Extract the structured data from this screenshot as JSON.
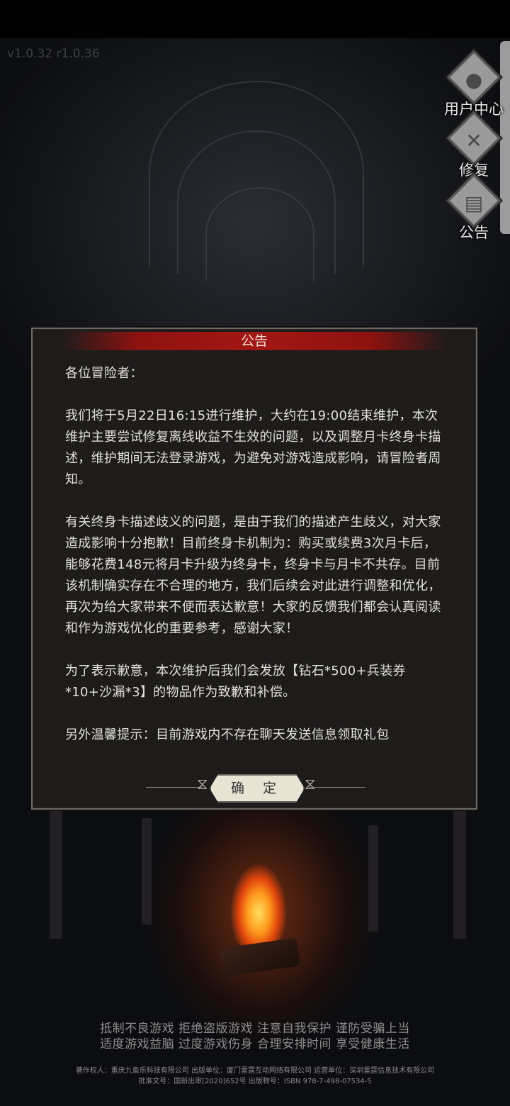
{
  "version": "v1.0.32 r1.0.36",
  "side_menu": [
    {
      "label": "用户中心",
      "icon": "user-icon"
    },
    {
      "label": "修复",
      "icon": "repair-tools-icon"
    },
    {
      "label": "公告",
      "icon": "notice-document-icon"
    }
  ],
  "dialog": {
    "title": "公告",
    "paragraphs": [
      "各位冒险者：",
      "我们将于5月22日16:15进行维护，大约在19:00结束维护，本次维护主要尝试修复离线收益不生效的问题，以及调整月卡终身卡描述，维护期间无法登录游戏，为避免对游戏造成影响，请冒险者周知。",
      "有关终身卡描述歧义的问题，是由于我们的描述产生歧义，对大家造成影响十分抱歉！目前终身卡机制为：购买或续费3次月卡后，能够花费148元将月卡升级为终身卡，终身卡与月卡不共存。目前该机制确实存在不合理的地方，我们后续会对此进行调整和优化，再次为给大家带来不便而表达歉意！大家的反馈我们都会认真阅读和作为游戏优化的重要参考，感谢大家！",
      "为了表示歉意，本次维护后我们会发放【钻石*500+兵装券*10+沙漏*3】的物品作为致歉和补偿。",
      "另外温馨提示：目前游戏内不存在聊天发送信息领取礼包"
    ],
    "confirm_label": "确 定"
  },
  "health_notice": [
    "抵制不良游戏 拒绝盗版游戏 注意自我保护 谨防受骗上当",
    "适度游戏益脑 过度游戏伤身 合理安排时间 享受健康生活"
  ],
  "copyright": [
    "著作权人：重庆九鱼乐科技有限公司 出版单位：厦门雷霆互动网络有限公司 运营单位：深圳雷霆信息技术有限公司",
    "批准文号：国新出审[2020]652号 出版物号：ISBN 978-7-498-07534-5"
  ]
}
